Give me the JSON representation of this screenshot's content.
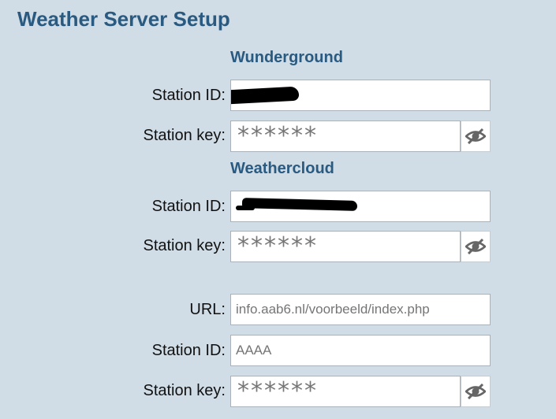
{
  "page": {
    "title": "Weather Server Setup"
  },
  "wunderground": {
    "heading": "Wunderground",
    "station_id_label": "Station ID:",
    "station_key_label": "Station key:",
    "station_key_mask": "******"
  },
  "weathercloud": {
    "heading": "Weathercloud",
    "station_id_label": "Station ID:",
    "station_key_label": "Station key:",
    "station_key_mask": "******"
  },
  "custom": {
    "url_label": "URL:",
    "url_placeholder": "info.aab6.nl/voorbeeld/index.php",
    "station_id_label": "Station ID:",
    "station_id_placeholder": "AAAA",
    "station_key_label": "Station key:",
    "station_key_mask": "******"
  },
  "icons": {
    "toggle_visibility": "eye-slash-icon"
  }
}
